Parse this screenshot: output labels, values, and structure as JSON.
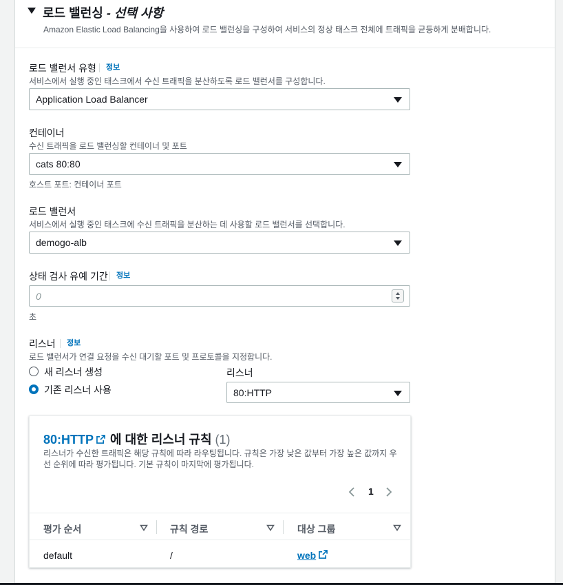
{
  "section": {
    "title": "로드 밸런싱",
    "title_suffix": "- 선택 사항",
    "description": "Amazon Elastic Load Balancing을 사용하여 로드 밸런싱을 구성하여 서비스의 정상 태스크 전체에 트래픽을 균등하게 분배합니다."
  },
  "lb_type": {
    "label": "로드 밸런서 유형",
    "info": "정보",
    "description": "서비스에서 실행 중인 태스크에서 수신 트래픽을 분산하도록 로드 밸런서를 구성합니다.",
    "value": "Application Load Balancer"
  },
  "container": {
    "label": "컨테이너",
    "description": "수신 트래픽을 로드 밸런싱할 컨테이너 및 포트",
    "value": "cats 80:80",
    "hint": "호스트 포트: 컨테이너 포트"
  },
  "load_balancer": {
    "label": "로드 밸런서",
    "description": "서비스에서 실행 중인 태스크에 수신 트래픽을 분산하는 데 사용할 로드 밸런서를 선택합니다.",
    "value": "demogo-alb"
  },
  "grace_period": {
    "label": "상태 검사 유예 기간",
    "info": "정보",
    "placeholder": "0",
    "unit": "초"
  },
  "listener": {
    "label": "리스너",
    "info": "정보",
    "description": "로드 밸런서가 연결 요청을 수신 대기할 포트 및 프로토콜을 지정합니다.",
    "option_new": "새 리스너 생성",
    "option_existing": "기존 리스너 사용",
    "selected": "existing",
    "select_label": "리스너",
    "select_value": "80:HTTP"
  },
  "rules": {
    "title_link": "80:HTTP",
    "title_rest": "에 대한 리스너 규칙",
    "count": "(1)",
    "description": "리스너가 수신한 트래픽은 해당 규칙에 따라 라우팅됩니다. 규칙은 가장 낮은 값부터 가장 높은 값까지 우선 순위에 따라 평가됩니다. 기본 규칙이 마지막에 평가됩니다.",
    "page": "1",
    "columns": [
      "평가 순서",
      "규칙 경로",
      "대상 그룹"
    ],
    "rows": [
      {
        "order": "default",
        "path": "/",
        "target": "web"
      }
    ]
  },
  "colors": {
    "link": "#0073bb",
    "text": "#16191f",
    "secondary": "#545b64"
  }
}
